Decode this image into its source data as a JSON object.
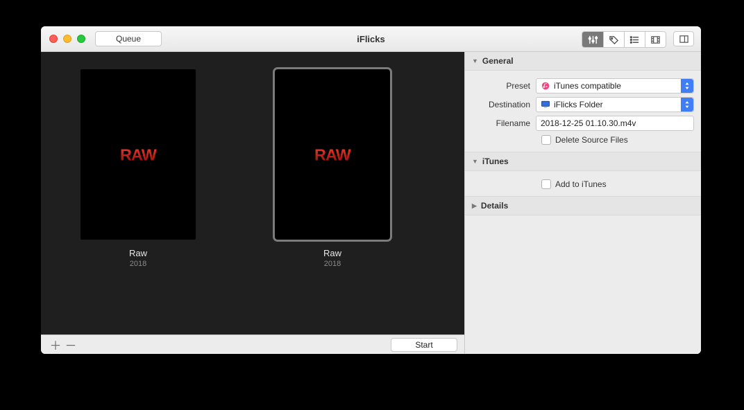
{
  "window": {
    "title": "iFlicks"
  },
  "toolbar": {
    "queue_label": "Queue",
    "segments": [
      "sliders",
      "tag",
      "list",
      "film",
      "panel"
    ]
  },
  "items": [
    {
      "title": "Raw",
      "year": "2018",
      "selected": false,
      "logo_text": "RAW"
    },
    {
      "title": "Raw",
      "year": "2018",
      "selected": true,
      "logo_text": "RAW"
    }
  ],
  "footer": {
    "start_label": "Start"
  },
  "sidebar": {
    "sections": {
      "general": {
        "label": "General",
        "expanded": true,
        "preset": {
          "label": "Preset",
          "value": "iTunes compatible",
          "icon": "itunes"
        },
        "destination": {
          "label": "Destination",
          "value": "iFlicks Folder",
          "icon": "monitor"
        },
        "filename": {
          "label": "Filename",
          "value": "2018-12-25 01.10.30.m4v"
        },
        "delete_source": {
          "label": "Delete Source Files",
          "checked": false
        }
      },
      "itunes": {
        "label": "iTunes",
        "expanded": true,
        "add_to_itunes": {
          "label": "Add to iTunes",
          "checked": false
        }
      },
      "details": {
        "label": "Details",
        "expanded": false
      }
    }
  }
}
